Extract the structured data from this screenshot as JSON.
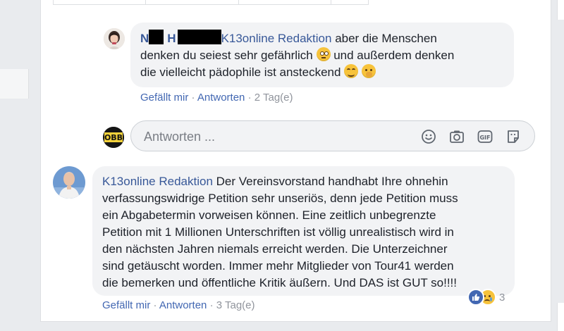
{
  "reply_comment": {
    "author_visible_part1": "N",
    "author_visible_part2": "H",
    "mention": "K13online Redaktion",
    "line1_rest": " aber die Menschen",
    "line2": "denken du seiest sehr gefährlich",
    "line3_a": " und außerdem denken",
    "line4": "die vielleicht pädophile ist ansteckend",
    "like_label": "Gefällt mir",
    "reply_label": "Antworten",
    "time": "2 Tag(e)"
  },
  "reply_box": {
    "placeholder": "Antworten ...",
    "avatar_text": "OBB"
  },
  "main_comment": {
    "author": "K13online Redaktion",
    "line1": " Der Vereinsvorstand handhabt Ihre ohnehin",
    "lines": [
      "verfassungswidrige Petition sehr unseriös, denn jede Petition muss",
      "ein Abgabetermin vorweisen können. Eine zeitlich unbegrenzte",
      "Petition mit 1 Millionen Unterschriften ist völlig unrealistisch wird in",
      "den nächsten Jahren niemals erreicht werden. Die Unterzeichner",
      "sind getäuscht worden. Immer mehr Mitglieder von Tour41 werden",
      "die bemerken und öffentliche Kritik äußern. Und DAS ist GUT so!!!!"
    ],
    "like_label": "Gefällt mir",
    "reply_label": "Antworten",
    "time": "3 Tag(e)",
    "reaction_count": "3"
  },
  "separator": " · ",
  "colors": {
    "link": "#385898",
    "action_link": "#4267b2",
    "bubble": "#f2f3f5",
    "muted": "#90949c"
  },
  "icons": [
    "emoji-icon",
    "camera-icon",
    "gif-icon",
    "sticker-icon",
    "like-reaction-icon",
    "sad-reaction-icon"
  ]
}
